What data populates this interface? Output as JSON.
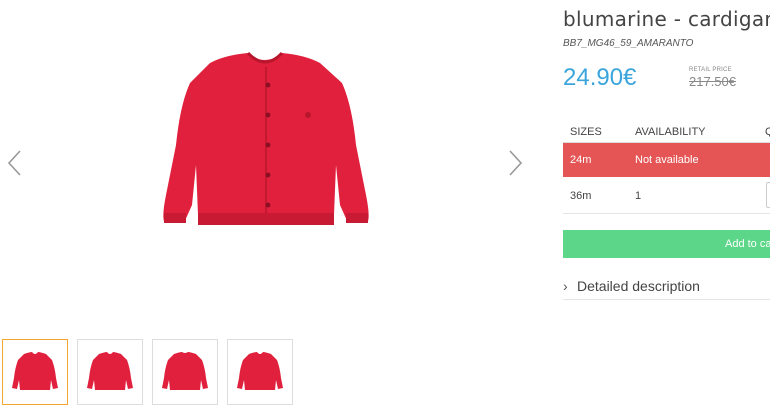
{
  "product": {
    "title": "blumarine - cardigan",
    "sku": "BB7_MG46_59_AMARANTO",
    "price": "24.90€",
    "retail_label": "RETAIL PRICE",
    "retail_price": "217.50€",
    "product_color": "#e0203c"
  },
  "sizes_table": {
    "headers": [
      "SIZES",
      "AVAILABILITY",
      "Q"
    ],
    "rows": [
      {
        "size": "24m",
        "availability": "Not available",
        "status_color": "#e55555"
      },
      {
        "size": "36m",
        "availability": "1"
      }
    ]
  },
  "actions": {
    "add_to_cart": "Add to ca"
  },
  "description": {
    "label": "Detailed description"
  },
  "icons": {
    "prev": "chevron-left-icon",
    "next": "chevron-right-icon",
    "desc": "chevron-right-icon"
  }
}
